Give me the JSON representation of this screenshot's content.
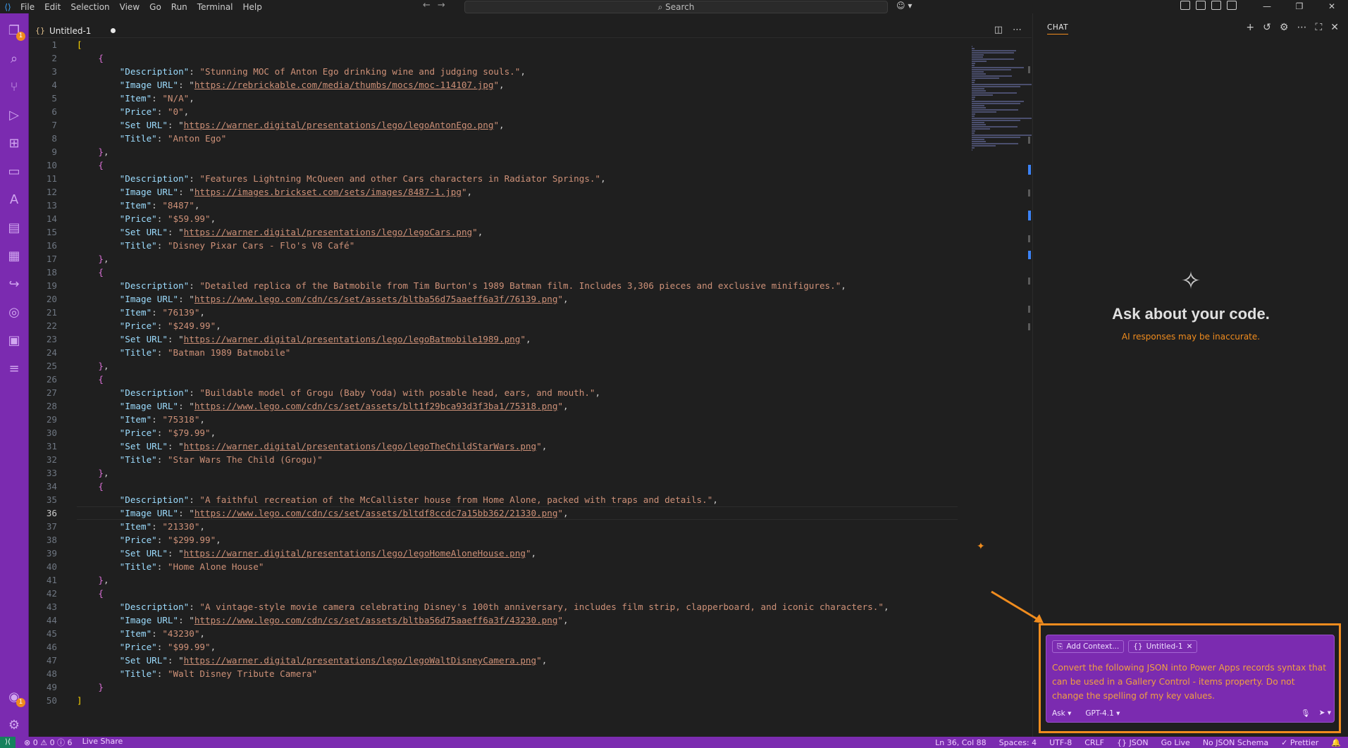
{
  "menu": [
    "File",
    "Edit",
    "Selection",
    "View",
    "Go",
    "Run",
    "Terminal",
    "Help"
  ],
  "search_label": "Search",
  "tab": {
    "name": "Untitled-1"
  },
  "code_lines": [
    [
      [
        "b1",
        "["
      ]
    ],
    [
      [
        "p",
        "    "
      ],
      [
        "b2",
        "{"
      ]
    ],
    [
      [
        "p",
        "        "
      ],
      [
        "k",
        "\"Description\""
      ],
      [
        "p",
        ": "
      ],
      [
        "s",
        "\"Stunning MOC of Anton Ego drinking wine and judging souls.\""
      ],
      [
        "p",
        ","
      ]
    ],
    [
      [
        "p",
        "        "
      ],
      [
        "k",
        "\"Image URL\""
      ],
      [
        "p",
        ": \""
      ],
      [
        "u",
        "https://rebrickable.com/media/thumbs/mocs/moc-114107.jpg"
      ],
      [
        "s",
        "\""
      ],
      [
        "p",
        ","
      ]
    ],
    [
      [
        "p",
        "        "
      ],
      [
        "k",
        "\"Item\""
      ],
      [
        "p",
        ": "
      ],
      [
        "s",
        "\"N/A\""
      ],
      [
        "p",
        ","
      ]
    ],
    [
      [
        "p",
        "        "
      ],
      [
        "k",
        "\"Price\""
      ],
      [
        "p",
        ": "
      ],
      [
        "s",
        "\"0\""
      ],
      [
        "p",
        ","
      ]
    ],
    [
      [
        "p",
        "        "
      ],
      [
        "k",
        "\"Set URL\""
      ],
      [
        "p",
        ": \""
      ],
      [
        "u",
        "https://warner.digital/presentations/lego/legoAntonEgo.png"
      ],
      [
        "s",
        "\""
      ],
      [
        "p",
        ","
      ]
    ],
    [
      [
        "p",
        "        "
      ],
      [
        "k",
        "\"Title\""
      ],
      [
        "p",
        ": "
      ],
      [
        "s",
        "\"Anton Ego\""
      ]
    ],
    [
      [
        "p",
        "    "
      ],
      [
        "b2",
        "}"
      ],
      [
        "p",
        ","
      ]
    ],
    [
      [
        "p",
        "    "
      ],
      [
        "b2",
        "{"
      ]
    ],
    [
      [
        "p",
        "        "
      ],
      [
        "k",
        "\"Description\""
      ],
      [
        "p",
        ": "
      ],
      [
        "s",
        "\"Features Lightning McQueen and other Cars characters in Radiator Springs.\""
      ],
      [
        "p",
        ","
      ]
    ],
    [
      [
        "p",
        "        "
      ],
      [
        "k",
        "\"Image URL\""
      ],
      [
        "p",
        ": \""
      ],
      [
        "u",
        "https://images.brickset.com/sets/images/8487-1.jpg"
      ],
      [
        "s",
        "\""
      ],
      [
        "p",
        ","
      ]
    ],
    [
      [
        "p",
        "        "
      ],
      [
        "k",
        "\"Item\""
      ],
      [
        "p",
        ": "
      ],
      [
        "s",
        "\"8487\""
      ],
      [
        "p",
        ","
      ]
    ],
    [
      [
        "p",
        "        "
      ],
      [
        "k",
        "\"Price\""
      ],
      [
        "p",
        ": "
      ],
      [
        "s",
        "\"$59.99\""
      ],
      [
        "p",
        ","
      ]
    ],
    [
      [
        "p",
        "        "
      ],
      [
        "k",
        "\"Set URL\""
      ],
      [
        "p",
        ": \""
      ],
      [
        "u",
        "https://warner.digital/presentations/lego/legoCars.png"
      ],
      [
        "s",
        "\""
      ],
      [
        "p",
        ","
      ]
    ],
    [
      [
        "p",
        "        "
      ],
      [
        "k",
        "\"Title\""
      ],
      [
        "p",
        ": "
      ],
      [
        "s",
        "\"Disney Pixar Cars - Flo's V8 Café\""
      ]
    ],
    [
      [
        "p",
        "    "
      ],
      [
        "b2",
        "}"
      ],
      [
        "p",
        ","
      ]
    ],
    [
      [
        "p",
        "    "
      ],
      [
        "b2",
        "{"
      ]
    ],
    [
      [
        "p",
        "        "
      ],
      [
        "k",
        "\"Description\""
      ],
      [
        "p",
        ": "
      ],
      [
        "s",
        "\"Detailed replica of the Batmobile from Tim Burton's 1989 Batman film. Includes 3,306 pieces and exclusive minifigures.\""
      ],
      [
        "p",
        ","
      ]
    ],
    [
      [
        "p",
        "        "
      ],
      [
        "k",
        "\"Image URL\""
      ],
      [
        "p",
        ": \""
      ],
      [
        "u",
        "https://www.lego.com/cdn/cs/set/assets/bltba56d75aaeff6a3f/76139.png"
      ],
      [
        "s",
        "\""
      ],
      [
        "p",
        ","
      ]
    ],
    [
      [
        "p",
        "        "
      ],
      [
        "k",
        "\"Item\""
      ],
      [
        "p",
        ": "
      ],
      [
        "s",
        "\"76139\""
      ],
      [
        "p",
        ","
      ]
    ],
    [
      [
        "p",
        "        "
      ],
      [
        "k",
        "\"Price\""
      ],
      [
        "p",
        ": "
      ],
      [
        "s",
        "\"$249.99\""
      ],
      [
        "p",
        ","
      ]
    ],
    [
      [
        "p",
        "        "
      ],
      [
        "k",
        "\"Set URL\""
      ],
      [
        "p",
        ": \""
      ],
      [
        "u",
        "https://warner.digital/presentations/lego/legoBatmobile1989.png"
      ],
      [
        "s",
        "\""
      ],
      [
        "p",
        ","
      ]
    ],
    [
      [
        "p",
        "        "
      ],
      [
        "k",
        "\"Title\""
      ],
      [
        "p",
        ": "
      ],
      [
        "s",
        "\"Batman 1989 Batmobile\""
      ]
    ],
    [
      [
        "p",
        "    "
      ],
      [
        "b2",
        "}"
      ],
      [
        "p",
        ","
      ]
    ],
    [
      [
        "p",
        "    "
      ],
      [
        "b2",
        "{"
      ]
    ],
    [
      [
        "p",
        "        "
      ],
      [
        "k",
        "\"Description\""
      ],
      [
        "p",
        ": "
      ],
      [
        "s",
        "\"Buildable model of Grogu (Baby Yoda) with posable head, ears, and mouth.\""
      ],
      [
        "p",
        ","
      ]
    ],
    [
      [
        "p",
        "        "
      ],
      [
        "k",
        "\"Image URL\""
      ],
      [
        "p",
        ": \""
      ],
      [
        "u",
        "https://www.lego.com/cdn/cs/set/assets/blt1f29bca93d3f3ba1/75318.png"
      ],
      [
        "s",
        "\""
      ],
      [
        "p",
        ","
      ]
    ],
    [
      [
        "p",
        "        "
      ],
      [
        "k",
        "\"Item\""
      ],
      [
        "p",
        ": "
      ],
      [
        "s",
        "\"75318\""
      ],
      [
        "p",
        ","
      ]
    ],
    [
      [
        "p",
        "        "
      ],
      [
        "k",
        "\"Price\""
      ],
      [
        "p",
        ": "
      ],
      [
        "s",
        "\"$79.99\""
      ],
      [
        "p",
        ","
      ]
    ],
    [
      [
        "p",
        "        "
      ],
      [
        "k",
        "\"Set URL\""
      ],
      [
        "p",
        ": \""
      ],
      [
        "u",
        "https://warner.digital/presentations/lego/legoTheChildStarWars.png"
      ],
      [
        "s",
        "\""
      ],
      [
        "p",
        ","
      ]
    ],
    [
      [
        "p",
        "        "
      ],
      [
        "k",
        "\"Title\""
      ],
      [
        "p",
        ": "
      ],
      [
        "s",
        "\"Star Wars The Child (Grogu)\""
      ]
    ],
    [
      [
        "p",
        "    "
      ],
      [
        "b2",
        "}"
      ],
      [
        "p",
        ","
      ]
    ],
    [
      [
        "p",
        "    "
      ],
      [
        "b2",
        "{"
      ]
    ],
    [
      [
        "p",
        "        "
      ],
      [
        "k",
        "\"Description\""
      ],
      [
        "p",
        ": "
      ],
      [
        "s",
        "\"A faithful recreation of the McCallister house from Home Alone, packed with traps and details.\""
      ],
      [
        "p",
        ","
      ]
    ],
    [
      [
        "p",
        "        "
      ],
      [
        "k",
        "\"Image URL\""
      ],
      [
        "p",
        ": \""
      ],
      [
        "u",
        "https://www.lego.com/cdn/cs/set/assets/bltdf8ccdc7a15bb362/21330.png"
      ],
      [
        "s",
        "\""
      ],
      [
        "p",
        ","
      ]
    ],
    [
      [
        "p",
        "        "
      ],
      [
        "k",
        "\"Item\""
      ],
      [
        "p",
        ": "
      ],
      [
        "s",
        "\"21330\""
      ],
      [
        "p",
        ","
      ]
    ],
    [
      [
        "p",
        "        "
      ],
      [
        "k",
        "\"Price\""
      ],
      [
        "p",
        ": "
      ],
      [
        "s",
        "\"$299.99\""
      ],
      [
        "p",
        ","
      ]
    ],
    [
      [
        "p",
        "        "
      ],
      [
        "k",
        "\"Set URL\""
      ],
      [
        "p",
        ": \""
      ],
      [
        "u",
        "https://warner.digital/presentations/lego/legoHomeAloneHouse.png"
      ],
      [
        "s",
        "\""
      ],
      [
        "p",
        ","
      ]
    ],
    [
      [
        "p",
        "        "
      ],
      [
        "k",
        "\"Title\""
      ],
      [
        "p",
        ": "
      ],
      [
        "s",
        "\"Home Alone House\""
      ]
    ],
    [
      [
        "p",
        "    "
      ],
      [
        "b2",
        "}"
      ],
      [
        "p",
        ","
      ]
    ],
    [
      [
        "p",
        "    "
      ],
      [
        "b2",
        "{"
      ]
    ],
    [
      [
        "p",
        "        "
      ],
      [
        "k",
        "\"Description\""
      ],
      [
        "p",
        ": "
      ],
      [
        "s",
        "\"A vintage-style movie camera celebrating Disney's 100th anniversary, includes film strip, clapperboard, and iconic characters.\""
      ],
      [
        "p",
        ","
      ]
    ],
    [
      [
        "p",
        "        "
      ],
      [
        "k",
        "\"Image URL\""
      ],
      [
        "p",
        ": \""
      ],
      [
        "u",
        "https://www.lego.com/cdn/cs/set/assets/bltba56d75aaeff6a3f/43230.png"
      ],
      [
        "s",
        "\""
      ],
      [
        "p",
        ","
      ]
    ],
    [
      [
        "p",
        "        "
      ],
      [
        "k",
        "\"Item\""
      ],
      [
        "p",
        ": "
      ],
      [
        "s",
        "\"43230\""
      ],
      [
        "p",
        ","
      ]
    ],
    [
      [
        "p",
        "        "
      ],
      [
        "k",
        "\"Price\""
      ],
      [
        "p",
        ": "
      ],
      [
        "s",
        "\"$99.99\""
      ],
      [
        "p",
        ","
      ]
    ],
    [
      [
        "p",
        "        "
      ],
      [
        "k",
        "\"Set URL\""
      ],
      [
        "p",
        ": \""
      ],
      [
        "u",
        "https://warner.digital/presentations/lego/legoWaltDisneyCamera.png"
      ],
      [
        "s",
        "\""
      ],
      [
        "p",
        ","
      ]
    ],
    [
      [
        "p",
        "        "
      ],
      [
        "k",
        "\"Title\""
      ],
      [
        "p",
        ": "
      ],
      [
        "s",
        "\"Walt Disney Tribute Camera\""
      ]
    ],
    [
      [
        "p",
        "    "
      ],
      [
        "b2",
        "}"
      ]
    ],
    [
      [
        "b1",
        "]"
      ]
    ]
  ],
  "current_line": 36,
  "chat": {
    "tab_label": "CHAT",
    "heading": "Ask about your code.",
    "disclaimer": "AI responses may be inaccurate.",
    "add_context": "Add Context...",
    "attached_file": "Untitled-1",
    "prompt": "Convert the following JSON into Power Apps records syntax that can be used in a Gallery Control - items property. Do not change the spelling of my key values.",
    "mode": "Ask",
    "model": "GPT-4.1"
  },
  "status": {
    "problems": "⊗ 0 ⚠ 0 ⓘ 6",
    "live_share": "Live Share",
    "position": "Ln 36, Col 88",
    "spaces": "Spaces: 4",
    "encoding": "UTF-8",
    "eol": "CRLF",
    "language": "{} JSON",
    "go_live": "Go Live",
    "schema": "No JSON Schema",
    "prettier": "✓ Prettier"
  },
  "colors": {
    "accent": "#7b2bb0",
    "highlight": "#f08c1e"
  }
}
